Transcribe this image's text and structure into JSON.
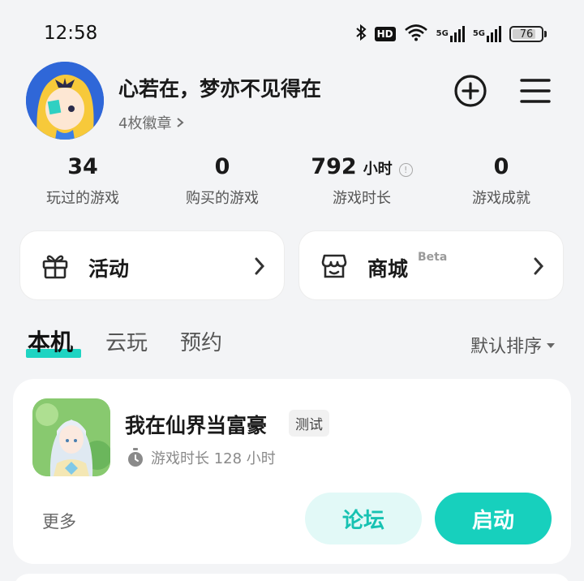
{
  "status_bar": {
    "time": "12:58",
    "hd_badge": "HD",
    "signal1_label": "5G",
    "signal2_label": "5G",
    "battery_level": "76",
    "icons": [
      "bluetooth-icon",
      "hd-icon",
      "wifi-icon",
      "signal-icon",
      "signal-icon",
      "battery-icon"
    ]
  },
  "profile": {
    "username": "心若在，梦亦不见得在",
    "badges_text": "4枚徽章",
    "add_icon": "plus-circle-icon",
    "menu_icon": "hamburger-menu-icon"
  },
  "stats": [
    {
      "value": "34",
      "unit": "",
      "label": "玩过的游戏"
    },
    {
      "value": "0",
      "unit": "",
      "label": "购买的游戏"
    },
    {
      "value": "792",
      "unit": "小时",
      "label": "游戏时长"
    },
    {
      "value": "0",
      "unit": "",
      "label": "游戏成就"
    }
  ],
  "cards": {
    "activity": {
      "label": "活动",
      "icon": "gift-icon"
    },
    "store": {
      "label": "商城",
      "tag": "Beta",
      "icon": "store-icon"
    }
  },
  "tabs": {
    "items": [
      "本机",
      "云玩",
      "预约"
    ],
    "active_index": 0,
    "sort_label": "默认排序"
  },
  "game": {
    "title": "我在仙界当富豪",
    "tag": "测试",
    "playtime": "游戏时长 128 小时",
    "more_label": "更多",
    "forum_label": "论坛",
    "launch_label": "启动"
  },
  "colors": {
    "accent": "#17d0bd",
    "accent_light": "#e2f9f7",
    "background": "#f3f4f6"
  }
}
